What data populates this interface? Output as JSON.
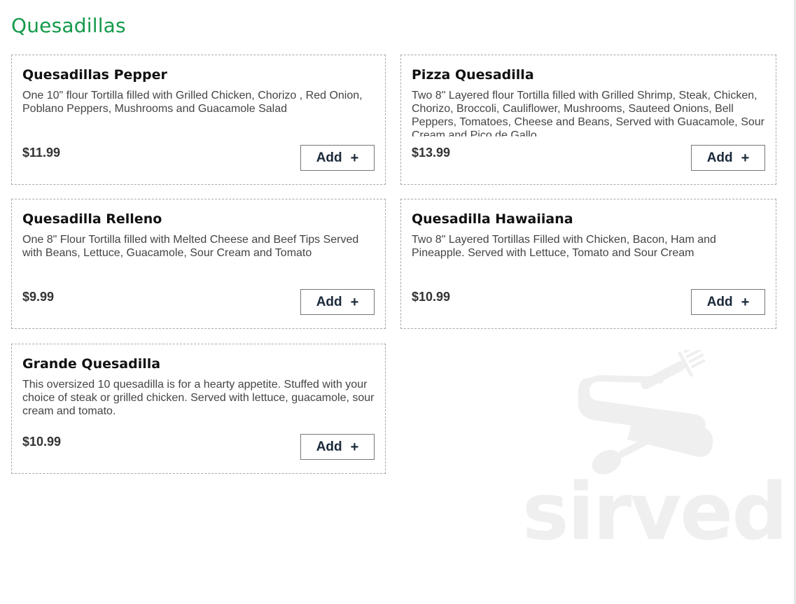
{
  "section": {
    "title": "Quesadillas"
  },
  "items": [
    {
      "name": "Quesadillas Pepper",
      "description": "One 10\" flour Tortilla filled with Grilled Chicken, Chorizo , Red Onion, Poblano Peppers, Mushrooms and Guacamole Salad",
      "price": "$11.99",
      "add_label": "Add"
    },
    {
      "name": "Pizza Quesadilla",
      "description": "Two 8\" Layered flour Tortilla filled with Grilled Shrimp, Steak, Chicken, Chorizo, Broccoli, Cauliflower, Mushrooms, Sauteed Onions, Bell Peppers, Tomatoes, Cheese and Beans, Served with Guacamole, Sour Cream and Pico de Gallo",
      "price": "$13.99",
      "add_label": "Add"
    },
    {
      "name": "Quesadilla Relleno",
      "description": "One 8\" Flour Tortilla filled with Melted Cheese and Beef Tips Served with Beans, Lettuce, Guacamole, Sour Cream and Tomato",
      "price": "$9.99",
      "add_label": "Add"
    },
    {
      "name": "Quesadilla Hawaiiana",
      "description": "Two 8\" Layered Tortillas Filled with Chicken, Bacon, Ham and Pineapple. Served with Lettuce, Tomato and Sour Cream",
      "price": "$10.99",
      "add_label": "Add"
    },
    {
      "name": "Grande Quesadilla",
      "description": "This oversized 10 quesadilla is for a hearty appetite. Stuffed with your choice of steak or grilled chicken. Served with lettuce, guacamole, sour cream and tomato.",
      "price": "$10.99",
      "add_label": "Add"
    }
  ],
  "icons": {
    "add": "plus-icon",
    "watermark": "sirved-logo"
  },
  "watermark": {
    "text": "sirved"
  },
  "colors": {
    "title": "#149a4a",
    "watermark": "#efefef"
  }
}
